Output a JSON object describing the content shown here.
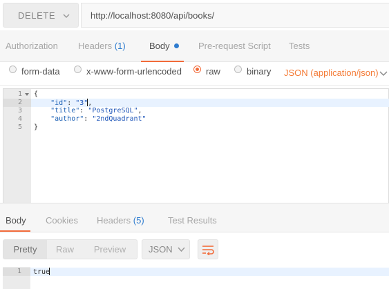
{
  "request": {
    "method": "DELETE",
    "url": "http://localhost:8080/api/books/"
  },
  "request_tabs": {
    "authorization": "Authorization",
    "headers": "Headers",
    "headers_count": "(1)",
    "body": "Body",
    "prerequest": "Pre-request Script",
    "tests": "Tests"
  },
  "body_options": {
    "form_data": "form-data",
    "urlencoded": "x-www-form-urlencoded",
    "raw": "raw",
    "binary": "binary",
    "selected": "raw",
    "content_type": "JSON (application/json)"
  },
  "editor": {
    "line_numbers": [
      "1",
      "2",
      "3",
      "4",
      "5"
    ],
    "line1": "{",
    "line2_key": "\"id\"",
    "line2_val": "\"3\"",
    "line3_key": "\"title\"",
    "line3_val": "\"PostgreSQL\"",
    "line4_key": "\"author\"",
    "line4_val": "\"2ndQuadrant\"",
    "line5": "}"
  },
  "response_tabs": {
    "body": "Body",
    "cookies": "Cookies",
    "headers": "Headers",
    "headers_count": "(5)",
    "test_results": "Test Results"
  },
  "response_view": {
    "pretty": "Pretty",
    "raw": "Raw",
    "preview": "Preview",
    "format": "JSON"
  },
  "response": {
    "line_number": "1",
    "value": "true"
  },
  "colors": {
    "accent": "#f26b3a",
    "link_blue": "#2f7ccf"
  },
  "icons": [
    "chevron-down-icon",
    "wrap-lines-icon",
    "fold-arrow-icon"
  ]
}
